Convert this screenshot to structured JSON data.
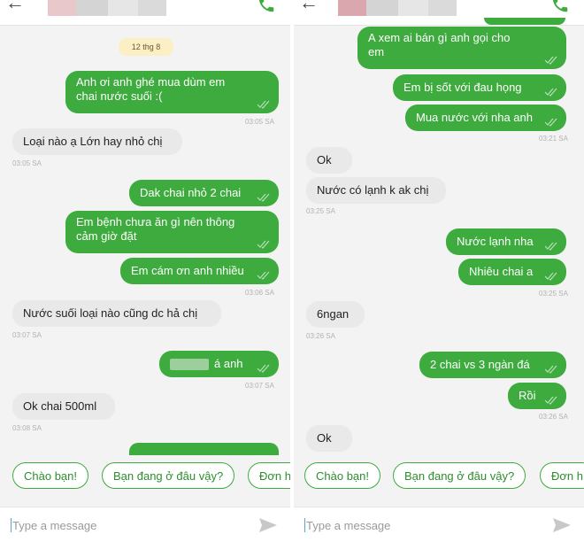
{
  "left": {
    "date_chip": "12 thg 8",
    "messages": [
      {
        "side": "out",
        "text": "Anh ơi anh ghé mua dùm em\nchai nước suối :(",
        "time": "03:05 SA"
      },
      {
        "side": "in",
        "text": "Loại nào ạ Lớn hay nhỏ chị",
        "time": "03:05 SA"
      },
      {
        "side": "out",
        "text": "Dak chai nhỏ 2 chai",
        "time": ""
      },
      {
        "side": "out",
        "text": "Em bệnh chưa ăn gì nên thông\ncảm giờ đặt",
        "time": ""
      },
      {
        "side": "out",
        "text": "Em cám ơn anh nhiều",
        "time": "03:06 SA"
      },
      {
        "side": "in",
        "text": "Nước suối loại nào cũng dc hả chị",
        "time": "03:07 SA"
      },
      {
        "side": "out",
        "text": "á anh",
        "time": "03:07 SA"
      },
      {
        "side": "in",
        "text": "Ok chai 500ml",
        "time": "03:08 SA"
      }
    ],
    "quick_replies": [
      "Chào bạn!",
      "Bạn đang ở đâu vậy?",
      "Đơn h"
    ],
    "input_placeholder": "Type a message"
  },
  "right": {
    "messages": [
      {
        "side": "out",
        "text": "A xem ai bán gì anh gọi cho\nem",
        "time": ""
      },
      {
        "side": "out",
        "text": "Em bị sốt với đau họng",
        "time": ""
      },
      {
        "side": "out",
        "text": "Mua nước với nha anh",
        "time": "03:21 SA"
      },
      {
        "side": "in",
        "text": "Ok",
        "time": ""
      },
      {
        "side": "in",
        "text": "Nước có lạnh k ak chị",
        "time": "03:25 SA"
      },
      {
        "side": "out",
        "text": "Nước lạnh nha",
        "time": ""
      },
      {
        "side": "out",
        "text": "Nhiêu chai a",
        "time": "03:25 SA"
      },
      {
        "side": "in",
        "text": "6ngan",
        "time": "03:26 SA"
      },
      {
        "side": "out",
        "text": "2 chai vs 3 ngàn đá",
        "time": ""
      },
      {
        "side": "out",
        "text": "Rồi",
        "time": "03:26 SA"
      },
      {
        "side": "in",
        "text": "Ok",
        "time": ""
      }
    ],
    "quick_replies": [
      "Chào bạn!",
      "Bạn đang ở đâu vậy?",
      "Đơn h"
    ],
    "input_placeholder": "Type a message"
  },
  "colors": {
    "outgoing_bubble": "#3dab3d",
    "incoming_bubble": "#e9e9e9",
    "accent": "#3dab3d"
  }
}
